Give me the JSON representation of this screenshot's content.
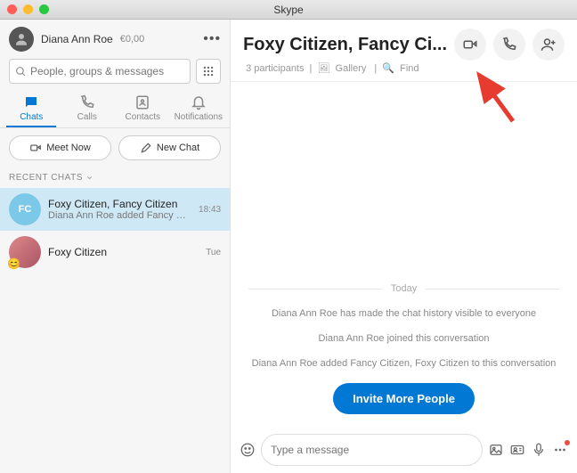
{
  "window": {
    "title": "Skype"
  },
  "profile": {
    "name": "Diana Ann Roe",
    "balance": "€0,00"
  },
  "search": {
    "placeholder": "People, groups & messages"
  },
  "tabs": {
    "chats": "Chats",
    "calls": "Calls",
    "contacts": "Contacts",
    "notifications": "Notifications"
  },
  "buttons": {
    "meet_now": "Meet Now",
    "new_chat": "New Chat"
  },
  "section_label": "RECENT CHATS",
  "recent": [
    {
      "initials": "FC",
      "title": "Foxy Citizen, Fancy Citizen",
      "subtitle": "Diana Ann Roe added Fancy …",
      "time": "18:43"
    },
    {
      "title": "Foxy Citizen",
      "time": "Tue"
    }
  ],
  "header": {
    "title": "Foxy Citizen, Fancy Ci...",
    "participants": "3 participants",
    "gallery": "Gallery",
    "find": "Find"
  },
  "thread": {
    "divider": "Today",
    "msgs": [
      "Diana Ann Roe has made the chat history visible to everyone",
      "Diana Ann Roe joined this conversation",
      "Diana Ann Roe added Fancy Citizen, Foxy Citizen to this conversation"
    ],
    "invite_label": "Invite More People"
  },
  "composer": {
    "placeholder": "Type a message"
  }
}
